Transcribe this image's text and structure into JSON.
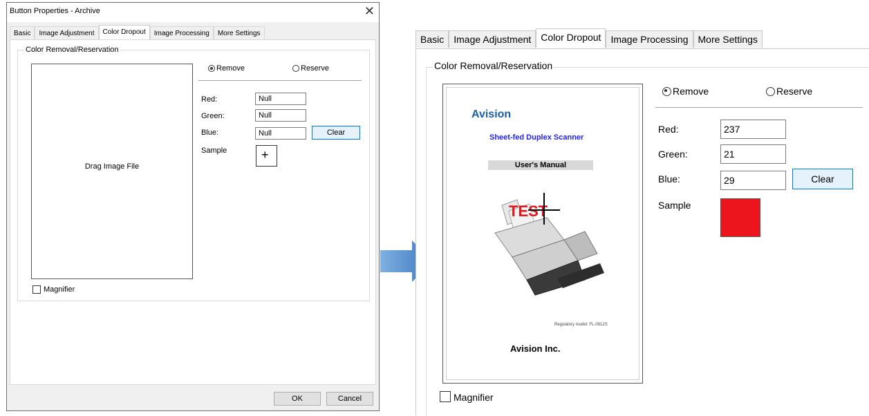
{
  "dialog": {
    "title": "Button Properties - Archive",
    "close_glyph": "✕",
    "tabs": [
      {
        "label": "Basic"
      },
      {
        "label": "Image Adjustment"
      },
      {
        "label": "Color Dropout"
      },
      {
        "label": "Image Processing"
      },
      {
        "label": "More Settings"
      }
    ],
    "active_tab": "Color Dropout",
    "group_label": "Color Removal/Reservation",
    "drop_area_text": "Drag Image File",
    "remove_label": "Remove",
    "reserve_label": "Reserve",
    "selected_mode": "Remove",
    "fields": {
      "red_label": "Red:",
      "red_value": "Null",
      "green_label": "Green:",
      "green_value": "Null",
      "blue_label": "Blue:",
      "blue_value": "Null"
    },
    "clear_label": "Clear",
    "sample_label": "Sample",
    "magnifier_label": "Magnifier",
    "ok_label": "OK",
    "cancel_label": "Cancel"
  },
  "zoomed": {
    "tabs": [
      {
        "label": "Basic"
      },
      {
        "label": "Image Adjustment"
      },
      {
        "label": "Color Dropout"
      },
      {
        "label": "Image Processing"
      },
      {
        "label": "More Settings"
      }
    ],
    "group_label": "Color Removal/Reservation",
    "preview": {
      "brand": "Avision",
      "subtitle": "Sheet-fed Duplex Scanner",
      "manual": "User's Manual",
      "test_text": "TEST",
      "regulatory": "Regulatory model: FL-0912S",
      "company": "Avision Inc."
    },
    "remove_label": "Remove",
    "reserve_label": "Reserve",
    "fields": {
      "red_label": "Red:",
      "red_value": "237",
      "green_label": "Green:",
      "green_value": "21",
      "blue_label": "Blue:",
      "blue_value": "29"
    },
    "clear_label": "Clear",
    "sample_label": "Sample",
    "sample_color": "#ED151D",
    "magnifier_label": "Magnifier"
  },
  "colors": {
    "arrow": "#4a86c8",
    "accent_blue": "#0078d7",
    "brand_blue": "#1a5fa8",
    "test_red": "#e3141c"
  }
}
